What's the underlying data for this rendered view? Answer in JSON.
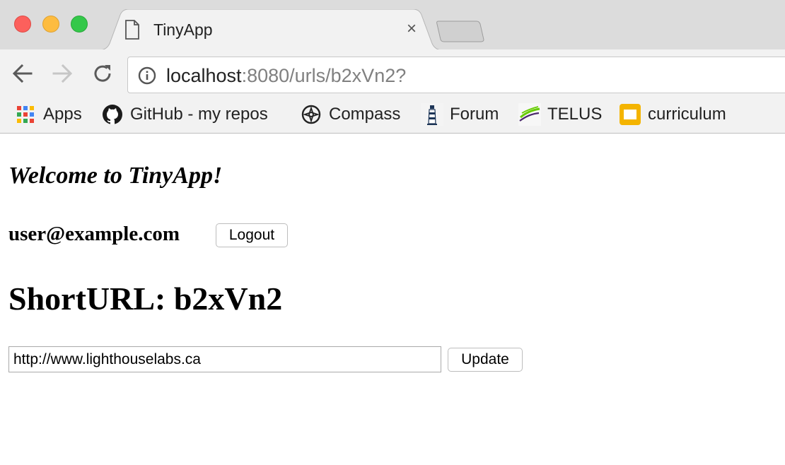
{
  "tab": {
    "title": "TinyApp",
    "close_glyph": "×"
  },
  "toolbar": {
    "url_host": "localhost",
    "url_rest": ":8080/urls/b2xVn2?"
  },
  "bookmarks": [
    {
      "label": "Apps",
      "icon": "apps-grid-icon"
    },
    {
      "label": "GitHub - my repos",
      "icon": "github-icon"
    },
    {
      "label": "Compass",
      "icon": "compass-icon"
    },
    {
      "label": "Forum",
      "icon": "lighthouse-icon"
    },
    {
      "label": "TELUS",
      "icon": "telus-icon"
    },
    {
      "label": "curriculum",
      "icon": "slides-icon"
    }
  ],
  "page": {
    "welcome": "Welcome to TinyApp!",
    "user_email": "user@example.com",
    "logout_label": "Logout",
    "short_url_heading": "ShortURL: b2xVn2",
    "long_url_value": "http://www.lighthouselabs.ca",
    "update_label": "Update"
  },
  "colors": {
    "traffic_red": "#fc605c",
    "traffic_yellow": "#fdbc40",
    "traffic_green": "#34c84a",
    "chrome_bg": "#f2f2f2",
    "tabstrip_bg": "#dcdcdc"
  }
}
